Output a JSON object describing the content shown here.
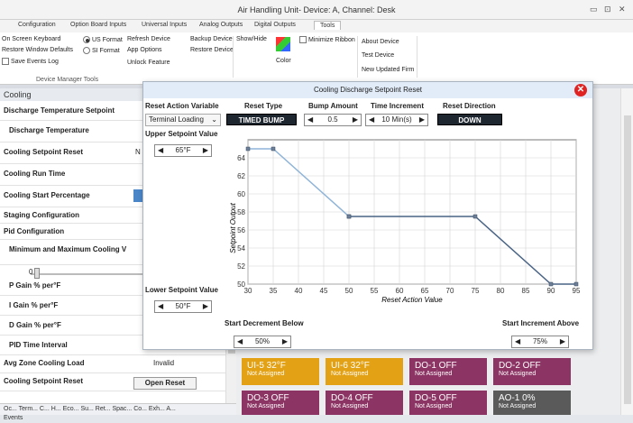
{
  "window": {
    "title": "Air Handling Unit- Device: A, Channel: Desk",
    "controls": [
      "▭",
      "⊡",
      "✕"
    ]
  },
  "tabs": [
    "Configuration",
    "Option Board Inputs",
    "Universal Inputs",
    "Analog Outputs",
    "Digital Outputs",
    "Tools"
  ],
  "ribbon": {
    "on_screen_keyboard": "On Screen Keyboard",
    "restore_defaults": "Restore Window Defaults",
    "save_events_log": "Save Events Log",
    "us_format": "US Format",
    "si_format": "SI Format",
    "refresh_device": "Refresh Device",
    "app_options": "App Options",
    "unlock_feature": "Unlock Feature",
    "backup_device": "Backup Device",
    "restore_device": "Restore Device",
    "show_hide": "Show/Hide",
    "minimize_ribbon": "Minimize Ribbon",
    "color": "Color",
    "about_device": "About Device",
    "test_device": "Test Device",
    "new_updated_firm": "New Updated Firm",
    "group_label": "Device Manager Tools"
  },
  "left_panel": {
    "header": "Cooling",
    "rows": [
      "Discharge Temperature Setpoint",
      "Discharge Temperature",
      "Cooling Setpoint Reset",
      "Cooling Run Time",
      "Cooling Start Percentage",
      "Staging Configuration",
      "Pid Configuration",
      "Minimum and Maximum Cooling V",
      "",
      "P Gain % per°F",
      "I Gain % per°F",
      "D Gain % per°F",
      "PID Time Interval",
      "Avg Zone Cooling Load",
      "Cooling Setpoint Reset"
    ],
    "avg_value": "Invalid",
    "open_reset": "Open Reset",
    "slider_value": "0",
    "row_n_label": "N"
  },
  "bottom_tabs": "Oc... Term... C... H... Eco... Su... Ret... Spac... Co... Exh... A...",
  "status": "Events",
  "tiles": [
    {
      "title": "UI-5  32°F",
      "sub": "Not Assigned",
      "color": "#e3a216"
    },
    {
      "title": "UI-6  32°F",
      "sub": "Not Assigned",
      "color": "#e3a216"
    },
    {
      "title": "DO-1  OFF",
      "sub": "Not Assigned",
      "color": "#8c3463"
    },
    {
      "title": "DO-2  OFF",
      "sub": "Not Assigned",
      "color": "#8c3463"
    },
    {
      "title": "DO-3  OFF",
      "sub": "Not Assigned",
      "color": "#8c3463"
    },
    {
      "title": "DO-4  OFF",
      "sub": "Not Assigned",
      "color": "#8c3463"
    },
    {
      "title": "DO-5  OFF",
      "sub": "Not Assigned",
      "color": "#8c3463"
    },
    {
      "title": "AO-1  0%",
      "sub": "Not Assigned",
      "color": "#5a5a5a"
    }
  ],
  "dialog": {
    "title": "Cooling Discharge Setpoint Reset",
    "reset_action_variable": "Reset Action Variable",
    "reset_action_value": "Terminal Loading",
    "reset_type": "Reset Type",
    "reset_type_value": "TIMED BUMP",
    "bump_amount": "Bump Amount",
    "bump_amount_value": "0.5",
    "time_increment": "Time Increment",
    "time_increment_value": "10 Min(s)",
    "reset_direction": "Reset Direction",
    "reset_direction_value": "DOWN",
    "upper_setpoint": "Upper Setpoint Value",
    "upper_value": "65°F",
    "lower_setpoint": "Lower Setpoint Value",
    "lower_value": "50°F",
    "start_decrement": "Start Decrement Below",
    "start_decrement_value": "50%",
    "start_increment": "Start Increment Above",
    "start_increment_value": "75%"
  },
  "chart_data": {
    "type": "line",
    "xlabel": "Reset Action Value",
    "ylabel": "Setpoint Output",
    "xlim": [
      30,
      95
    ],
    "ylim": [
      50,
      66
    ],
    "x_ticks": [
      30,
      35,
      40,
      45,
      50,
      55,
      60,
      65,
      70,
      75,
      80,
      85,
      90,
      95
    ],
    "y_ticks": [
      50,
      52,
      54,
      56,
      58,
      60,
      62,
      64
    ],
    "grid": true,
    "series": [
      {
        "color": "#8fb4d8",
        "x": [
          30,
          35,
          50
        ],
        "y": [
          65,
          65,
          57.5
        ]
      },
      {
        "color": "#4a6485",
        "x": [
          50,
          75,
          90,
          95
        ],
        "y": [
          57.5,
          57.5,
          50,
          50
        ]
      }
    ]
  }
}
